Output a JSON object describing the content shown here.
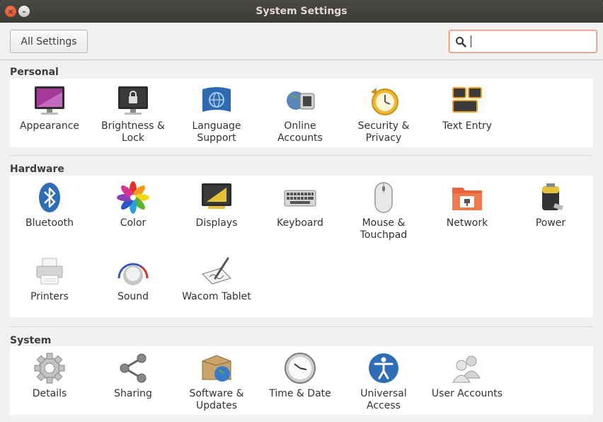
{
  "window": {
    "title": "System Settings",
    "close_glyph": "×",
    "min_glyph": "–"
  },
  "toolbar": {
    "all_settings_label": "All Settings",
    "search_value": "",
    "search_icon": "search-icon"
  },
  "sections": {
    "personal": {
      "title": "Personal",
      "items": [
        {
          "label": "Appearance",
          "icon": "appearance-icon"
        },
        {
          "label": "Brightness &\nLock",
          "icon": "brightness-lock-icon"
        },
        {
          "label": "Language\nSupport",
          "icon": "language-support-icon"
        },
        {
          "label": "Online\nAccounts",
          "icon": "online-accounts-icon"
        },
        {
          "label": "Security &\nPrivacy",
          "icon": "security-privacy-icon"
        },
        {
          "label": "Text Entry",
          "icon": "text-entry-icon"
        }
      ]
    },
    "hardware": {
      "title": "Hardware",
      "items": [
        {
          "label": "Bluetooth",
          "icon": "bluetooth-icon"
        },
        {
          "label": "Color",
          "icon": "color-icon"
        },
        {
          "label": "Displays",
          "icon": "displays-icon"
        },
        {
          "label": "Keyboard",
          "icon": "keyboard-icon"
        },
        {
          "label": "Mouse &\nTouchpad",
          "icon": "mouse-touchpad-icon"
        },
        {
          "label": "Network",
          "icon": "network-icon"
        },
        {
          "label": "Power",
          "icon": "power-icon"
        },
        {
          "label": "Printers",
          "icon": "printers-icon"
        },
        {
          "label": "Sound",
          "icon": "sound-icon"
        },
        {
          "label": "Wacom Tablet",
          "icon": "wacom-tablet-icon"
        }
      ]
    },
    "system": {
      "title": "System",
      "items": [
        {
          "label": "Details",
          "icon": "details-icon"
        },
        {
          "label": "Sharing",
          "icon": "sharing-icon"
        },
        {
          "label": "Software &\nUpdates",
          "icon": "software-updates-icon"
        },
        {
          "label": "Time & Date",
          "icon": "time-date-icon"
        },
        {
          "label": "Universal\nAccess",
          "icon": "universal-access-icon"
        },
        {
          "label": "User Accounts",
          "icon": "user-accounts-icon"
        }
      ]
    }
  },
  "colors": {
    "titlebar": "#3c3b37",
    "accent": "#df4a16",
    "focus_border": "#e9896c"
  }
}
